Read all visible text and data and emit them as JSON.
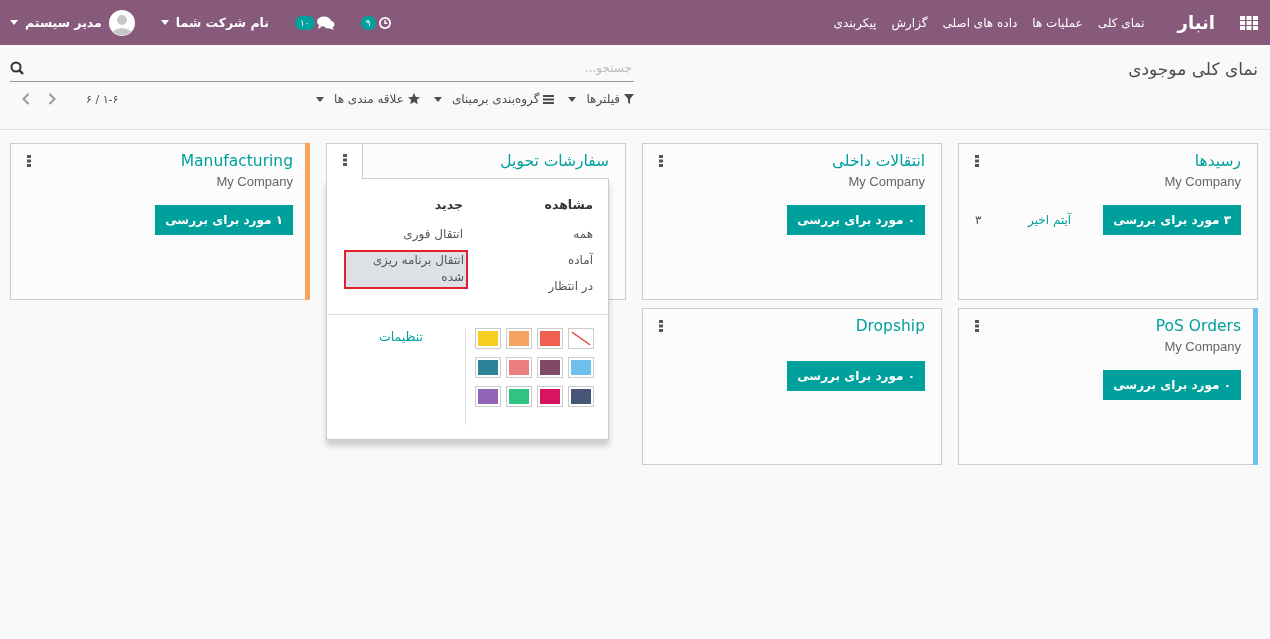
{
  "navbar": {
    "app_title": "انبار",
    "menu": [
      "نمای کلی",
      "عملیات ها",
      "داده های اصلی",
      "گزارش",
      "پیکربندی"
    ],
    "activity_badge": "۹",
    "messages_badge": "۱۰",
    "company": "نام شرکت شما",
    "user": "مدیر سیستم"
  },
  "control_panel": {
    "breadcrumb": "نمای کلی موجودی",
    "search": {
      "placeholder": "جستجو..."
    },
    "filters": [
      {
        "label": "فیلترها",
        "kind": "filter"
      },
      {
        "label": "گروه‌بندی برمبنای",
        "kind": "group"
      },
      {
        "label": "علاقه مندی ها",
        "kind": "favorite"
      }
    ],
    "pager": "۱-۶ / ۶"
  },
  "cards": [
    {
      "title": "رسیدها",
      "company": "My Company",
      "button": "۳ مورد برای بررسی",
      "recent": {
        "label": "آیتم اخیر",
        "count": "۳"
      },
      "menu_open": false
    },
    {
      "title": "انتقالات داخلی",
      "company": "My Company",
      "button": "۰ مورد برای بررسی",
      "menu_open": false
    },
    {
      "title": "سفارشات تحویل",
      "menu_open": true,
      "dropdown": {
        "sections": [
          {
            "heading": "مشاهده",
            "items": [
              {
                "label": "همه",
                "highlighted": false
              },
              {
                "label": "آماده",
                "highlighted": false
              },
              {
                "label": "در انتظار",
                "highlighted": false
              }
            ]
          },
          {
            "heading": "جدید",
            "items": [
              {
                "label": "انتقال فوری",
                "highlighted": false
              },
              {
                "label": "انتقال برنامه ریزی شده",
                "highlighted": true
              }
            ]
          }
        ],
        "colors": [
          {
            "kind": "none"
          },
          {
            "kind": "color",
            "color": "#f06050"
          },
          {
            "kind": "color",
            "color": "#f4a460"
          },
          {
            "kind": "color",
            "color": "#f7cd1f"
          },
          {
            "kind": "color",
            "color": "#6cc1ed"
          },
          {
            "kind": "color",
            "color": "#814968"
          },
          {
            "kind": "color",
            "color": "#eb7e7f"
          },
          {
            "kind": "color",
            "color": "#2c8397"
          },
          {
            "kind": "color",
            "color": "#475577"
          },
          {
            "kind": "color",
            "color": "#d6145f"
          },
          {
            "kind": "color",
            "color": "#30c381"
          },
          {
            "kind": "color",
            "color": "#9365b8"
          }
        ],
        "settings_link": "تنظیمات"
      }
    },
    {
      "title": "Manufacturing",
      "company": "My Company",
      "button": "۱ مورد برای بررسی",
      "color": "#f4a460",
      "menu_open": false
    },
    {
      "title": "PoS Orders",
      "company": "My Company",
      "button": "۰ مورد برای بررسی",
      "color": "#6cc1ed",
      "menu_open": false
    },
    {
      "title": "Dropship",
      "button": "۰ مورد برای بررسی",
      "menu_open": false
    }
  ]
}
